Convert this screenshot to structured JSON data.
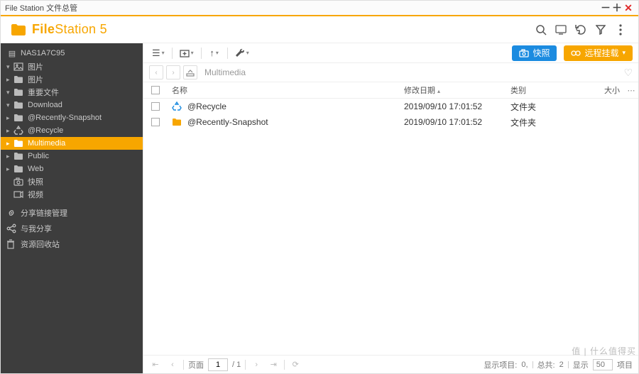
{
  "window": {
    "title": "File Station 文件总管"
  },
  "brand": {
    "name_html": "FileStation 5"
  },
  "toolbar_buttons": {
    "snapshot": "快照",
    "remote_mount": "远程挂载"
  },
  "breadcrumb": {
    "path": "Multimedia"
  },
  "columns": {
    "name": "名称",
    "modified": "修改日期",
    "kind": "类别",
    "size": "大小"
  },
  "rows": [
    {
      "icon": "recycle",
      "name": "@Recycle",
      "modified": "2019/09/10 17:01:52",
      "kind": "文件夹",
      "size": ""
    },
    {
      "icon": "folder",
      "name": "@Recently-Snapshot",
      "modified": "2019/09/10 17:01:52",
      "kind": "文件夹",
      "size": ""
    }
  ],
  "sidebar": {
    "root": "NAS1A7C95",
    "items": [
      {
        "lvl": 1,
        "arrow": "▾",
        "icon": "picture",
        "label": "图片"
      },
      {
        "lvl": 2,
        "arrow": "▸",
        "icon": "folder",
        "label": "图片"
      },
      {
        "lvl": 1,
        "arrow": "▾",
        "icon": "folder",
        "label": "重要文件"
      },
      {
        "lvl": 2,
        "arrow": "▾",
        "icon": "folder",
        "label": "Download"
      },
      {
        "lvl": 3,
        "arrow": "▸",
        "icon": "folder",
        "label": "@Recently-Snapshot"
      },
      {
        "lvl": 3,
        "arrow": "▸",
        "icon": "recycle",
        "label": "@Recycle"
      },
      {
        "lvl": 2,
        "arrow": "▸",
        "icon": "folder",
        "label": "Multimedia",
        "selected": true
      },
      {
        "lvl": 2,
        "arrow": "▸",
        "icon": "folder",
        "label": "Public"
      },
      {
        "lvl": 2,
        "arrow": "▸",
        "icon": "folder",
        "label": "Web"
      },
      {
        "lvl": 1,
        "arrow": "",
        "icon": "camera",
        "label": "快照"
      },
      {
        "lvl": 1,
        "arrow": "",
        "icon": "video",
        "label": "视频"
      }
    ],
    "bottom": [
      {
        "icon": "link",
        "label": "分享链接管理"
      },
      {
        "icon": "share",
        "label": "与我分享"
      },
      {
        "icon": "trash",
        "label": "资源回收站"
      }
    ]
  },
  "pager": {
    "page_label": "页面",
    "page": "1",
    "total_pages": "/ 1",
    "summary_items_label": "显示项目:",
    "summary_items_range": "0,",
    "summary_total_label": "总共:",
    "summary_total": "2",
    "summary_show_label": "显示",
    "page_size": "50",
    "items_unit": "项目"
  },
  "watermark": "值 | 什么值得买"
}
